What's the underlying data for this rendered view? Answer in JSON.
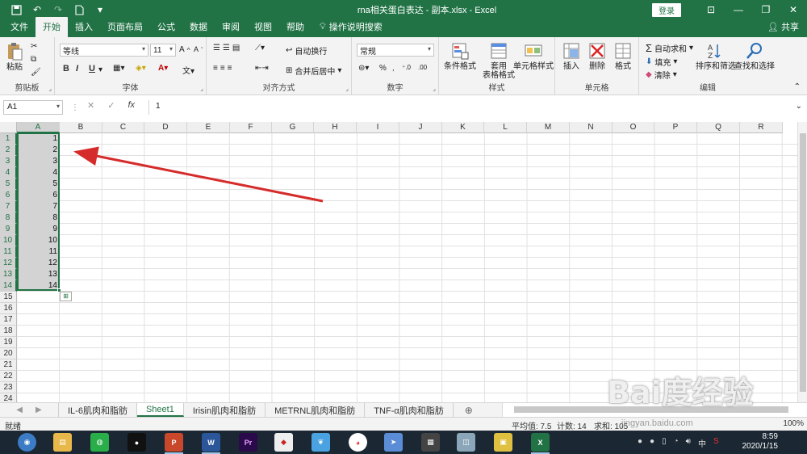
{
  "app": {
    "title": "rna相关蛋白表达 - 副本.xlsx  -  Excel",
    "login_label": "登录",
    "accent": "#217346"
  },
  "ribbon_tabs": [
    "文件",
    "开始",
    "插入",
    "页面布局",
    "公式",
    "数据",
    "审阅",
    "视图",
    "帮助"
  ],
  "active_tab": "开始",
  "tell_me": "操作说明搜索",
  "share_label": "共享",
  "clipboard": {
    "paste": "粘贴",
    "label": "剪贴板"
  },
  "font": {
    "name": "等线",
    "size": "11",
    "bold": "B",
    "italic": "I",
    "underline": "U",
    "label": "字体"
  },
  "alignment": {
    "wrap": "自动换行",
    "merge": "合并后居中",
    "label": "对齐方式"
  },
  "number": {
    "format": "常规",
    "label": "数字"
  },
  "styles": {
    "conditional": "条件格式",
    "table_format": "套用\n表格格式",
    "cell_styles": "单元格样式",
    "label": "样式"
  },
  "cells_group": {
    "insert": "插入",
    "delete": "删除",
    "format": "格式",
    "label": "单元格"
  },
  "editing": {
    "autosum": "自动求和",
    "fill": "填充",
    "clear": "清除",
    "sort": "排序和筛选",
    "find": "查找和选择",
    "label": "编辑"
  },
  "formula_bar": {
    "name_box": "A1",
    "fx": "fx",
    "value": "1"
  },
  "columns": [
    "A",
    "B",
    "C",
    "D",
    "E",
    "F",
    "G",
    "H",
    "I",
    "J",
    "K",
    "L",
    "M",
    "N",
    "O",
    "P",
    "Q",
    "R"
  ],
  "rows": [
    "1",
    "2",
    "3",
    "4",
    "5",
    "6",
    "7",
    "8",
    "9",
    "10",
    "11",
    "12",
    "13",
    "14",
    "15",
    "16",
    "17",
    "18",
    "19",
    "20",
    "21",
    "22",
    "23",
    "24"
  ],
  "column_a_values": [
    "1",
    "2",
    "3",
    "4",
    "5",
    "6",
    "7",
    "8",
    "9",
    "10",
    "11",
    "12",
    "13",
    "14"
  ],
  "sheets": [
    "IL-6肌肉和脂肪",
    "Sheet1",
    "Irisin肌肉和脂肪",
    "METRNL肌肉和脂肪",
    "TNF-α肌肉和脂肪"
  ],
  "active_sheet": "Sheet1",
  "status": {
    "ready": "就绪",
    "average": "平均值: 7.5",
    "count": "计数: 14",
    "sum": "求和: 105",
    "zoom": "100%"
  },
  "taskbar": {
    "time": "8:59",
    "date": "2020/1/15"
  },
  "watermark": {
    "text": "Bai度经验",
    "url": "jingyan.baidu.com"
  }
}
